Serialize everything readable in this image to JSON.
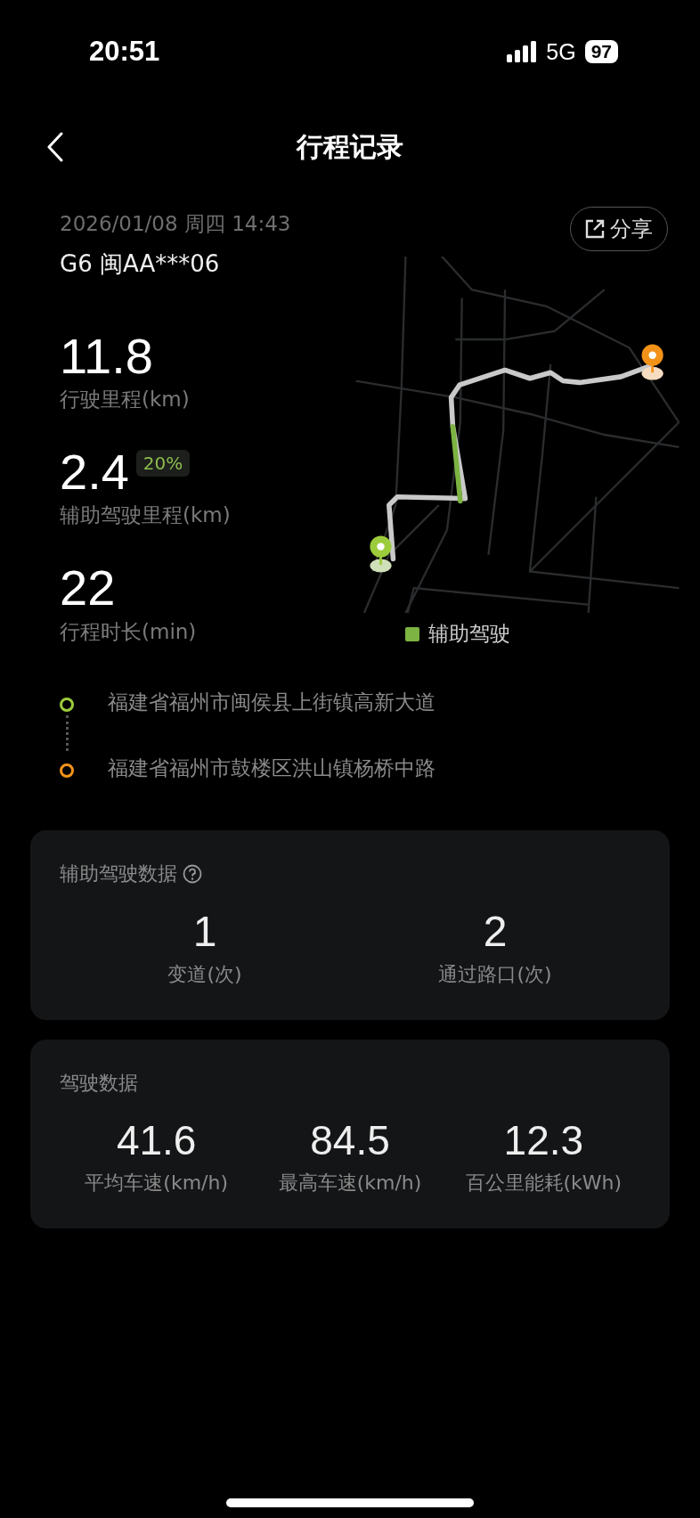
{
  "status_bar": {
    "time": "20:51",
    "network": "5G",
    "battery": "97"
  },
  "header": {
    "title": "行程记录"
  },
  "trip": {
    "datetime": "2026/01/08 周四 14:43",
    "vehicle": "G6 闽AA***06",
    "share_button": "分享"
  },
  "stats": [
    {
      "value": "11.8",
      "label": "行驶里程(km)"
    },
    {
      "value": "2.4",
      "badge": "20%",
      "label": "辅助驾驶里程(km)"
    },
    {
      "value": "22",
      "label": "行程时长(min)"
    }
  ],
  "map": {
    "legend": {
      "label": "辅助驾驶",
      "color": "#7cb342"
    }
  },
  "route": [
    {
      "kind": "start",
      "address": "福建省福州市闽侯县上街镇高新大道",
      "color": "#9ccc3c"
    },
    {
      "kind": "end",
      "address": "福建省福州市鼓楼区洪山镇杨桥中路",
      "color": "#f39219"
    }
  ],
  "cards": [
    {
      "title": "辅助驾驶数据",
      "has_help": true,
      "metrics": [
        {
          "value": "1",
          "label": "变道(次)"
        },
        {
          "value": "2",
          "label": "通过路口(次)"
        }
      ]
    },
    {
      "title": "驾驶数据",
      "has_help": false,
      "metrics": [
        {
          "value": "41.6",
          "label": "平均车速(km/h)"
        },
        {
          "value": "84.5",
          "label": "最高车速(km/h)"
        },
        {
          "value": "12.3",
          "label": "百公里能耗(kWh)"
        }
      ]
    }
  ]
}
